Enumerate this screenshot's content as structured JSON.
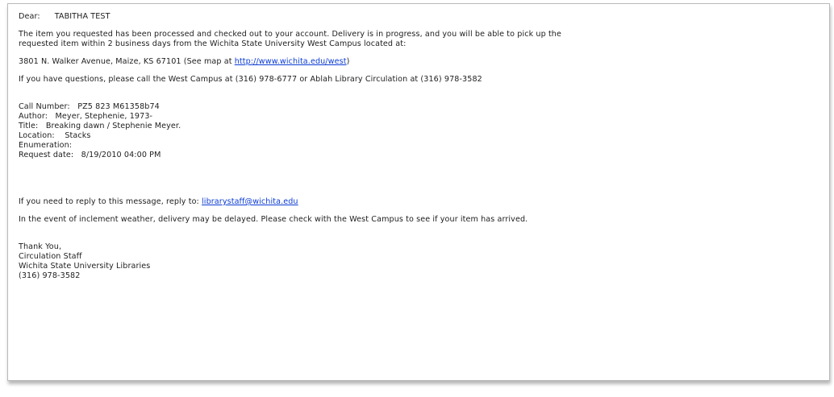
{
  "email": {
    "greeting": {
      "label": "Dear:",
      "name": "TABITHA TEST"
    },
    "paragraph1": {
      "line1": "The item you requested has been processed and checked out to your account. Delivery is in progress, and you will be able to pick up the",
      "line2": "requested item within 2 business days from the Wichita State University West Campus located at:"
    },
    "address": {
      "text": "3801 N. Walker Avenue, Maize, KS 67101 (See map at",
      "link": "http://www.wichita.edu/west",
      "close": ")"
    },
    "questions": "If you have questions, please call the West Campus at (316) 978-6777 or Ablah Library Circulation at (316) 978-3582",
    "item": {
      "call_number_label": "Call Number:",
      "call_number": "PZ5 823 M61358b74",
      "author_label": "Author:",
      "author": "Meyer, Stephenie, 1973-",
      "title_label": "Title:",
      "title": "Breaking dawn / Stephenie Meyer.",
      "location_label": "Location:",
      "location": "Stacks",
      "enumeration_label": "Enumeration:",
      "request_date_label": "Request date:",
      "request_date": "8/19/2010 04:00 PM"
    },
    "reply": {
      "text": "If you need to reply to this message, reply to:",
      "link": "librarystaff@wichita.edu"
    },
    "weather": "In the event of inclement weather, delivery may be delayed. Please check with the West Campus to see if your item has arrived.",
    "signature": {
      "line1": "Thank You,",
      "line2": "Circulation Staff",
      "line3": "Wichita State University Libraries",
      "line4": "(316) 978-3582"
    }
  }
}
